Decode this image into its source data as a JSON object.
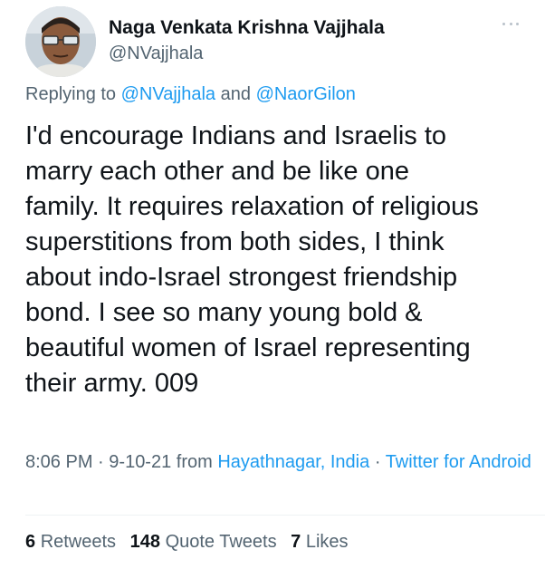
{
  "author": {
    "display_name": "Naga Venkata Krishna Vajjhala",
    "handle": "@NVajjhala"
  },
  "reply": {
    "prefix": "Replying to",
    "mention_1": "@NVajjhala",
    "conjunction": "and",
    "mention_2": "@NaorGilon"
  },
  "tweet": {
    "text": "I'd encourage Indians and Israelis to\nmarry each other and be like one\nfamily. It requires relaxation of religious\nsuperstitions from both sides, I think\nabout indo-Israel strongest friendship\nbond. I see so many young bold &\nbeautiful women of Israel representing\ntheir army. 009"
  },
  "meta": {
    "time": "8:06 PM",
    "date": "9-10-21",
    "from_label": "from",
    "location": "Hayathnagar, India",
    "source": "Twitter for Android"
  },
  "stats": {
    "retweets_count": "6",
    "retweets_label": "Retweets",
    "quote_count": "148",
    "quote_label": "Quote Tweets",
    "likes_count": "7",
    "likes_label": "Likes"
  },
  "icons": {
    "more": "more-horizontal-icon"
  },
  "colors": {
    "accent": "#1d9bf0",
    "text": "#0f1419",
    "secondary": "#536471"
  }
}
